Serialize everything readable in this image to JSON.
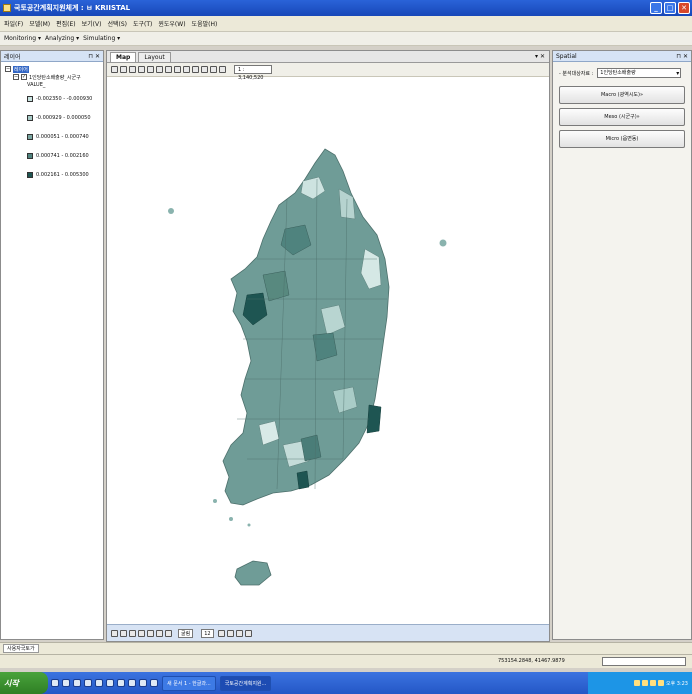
{
  "window": {
    "title": "국토공간계획지원체계 : ㅂ KRIISTAL"
  },
  "menu": [
    "파일(F)",
    "모델(M)",
    "편집(E)",
    "보기(V)",
    "선택(S)",
    "도구(T)",
    "윈도우(W)",
    "도움말(H)"
  ],
  "toolbar": {
    "items": [
      "Monitoring ▾",
      "Analyzing ▾",
      "Simulating ▾"
    ]
  },
  "layers_panel": {
    "title": "레이어",
    "root_label": "레이어",
    "layer_name": "1인당탄소배출량_시군구",
    "field_name": "VALUE_",
    "legend": [
      {
        "label": "-0.002350 - -0.000930",
        "color": "#c9e3e0"
      },
      {
        "label": "-0.000929 - 0.000050",
        "color": "#a8cac6"
      },
      {
        "label": "0.000051 - 0.000740",
        "color": "#7aa6a1"
      },
      {
        "label": "0.000741 - 0.002160",
        "color": "#4f837e"
      },
      {
        "label": "0.002161 - 0.005300",
        "color": "#1e5552"
      }
    ]
  },
  "map": {
    "tabs": [
      "Map",
      "Layout"
    ],
    "scale": "1 : 3,140,520",
    "font_name": "굴림",
    "font_size": "12"
  },
  "spatial_panel": {
    "title": "Spatial",
    "target_label": "- 분석대상자료 :",
    "target_value": "1인당탄소배출량",
    "buttons": [
      "Macro (광역시도)»",
      "Meso (시군구)»",
      "Micro (읍면동)"
    ]
  },
  "bottom_tab": "사용자국토가",
  "status": {
    "coords": "753154.2848, 41467.9879"
  },
  "taskbar": {
    "start": "시작",
    "tasks": [
      "새 문서 1 - 한글과...",
      "국토공간계획지원..."
    ],
    "clock": "오후 3:23"
  }
}
